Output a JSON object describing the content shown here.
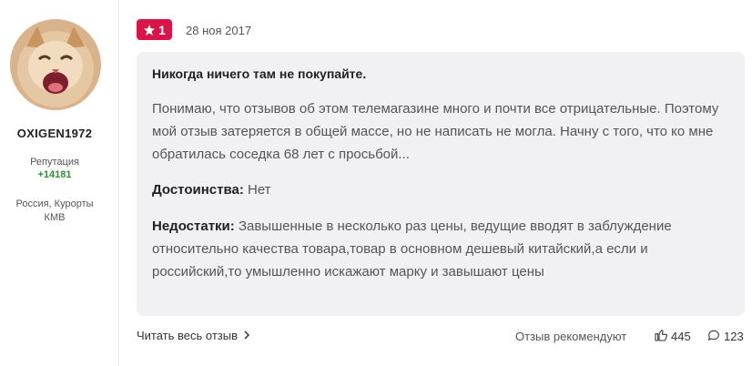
{
  "author": {
    "username": "OXIGEN1972",
    "reputation_label": "Репутация",
    "reputation_value": "+14181",
    "location": "Россия, Курорты КМВ"
  },
  "review": {
    "rating": "1",
    "date": "28 ноя 2017",
    "title": "Никогда ничего там не покупайте.",
    "body": "Понимаю, что отзывов об этом телемагазине много и почти все отрицательные. Поэтому мой отзыв затеряется в общей массе, но не написать не могла. Начну с того, что ко мне обратилась соседка 68 лет с просьбой...",
    "pros_label": "Достоинства:",
    "pros_text": "Нет",
    "cons_label": "Недостатки:",
    "cons_text": "Завышенные в несколько раз цены, ведущие вводят в заблуждение относительно качества товара,товар в основном дешевый китайский,а если и российский,то умышленно искажают марку и завышают цены"
  },
  "footer": {
    "read_more": "Читать весь отзыв",
    "recommend_label": "Отзыв рекомендуют",
    "likes": "445",
    "comments": "123"
  },
  "icons": {
    "rating": "star-icon",
    "read_more": "chevron-right-icon",
    "likes": "thumbs-up-icon",
    "comments": "comment-icon"
  },
  "colors": {
    "badge": "#d6164a",
    "reputation": "#2f8f2f",
    "review_bg": "#f1f1f3"
  }
}
